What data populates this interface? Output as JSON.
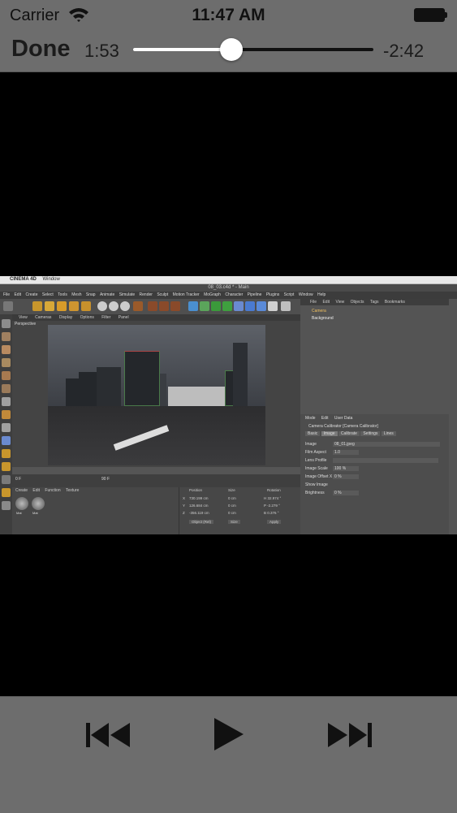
{
  "status_bar": {
    "carrier": "Carrier",
    "time": "11:47 AM",
    "wifi_icon": "wifi-icon",
    "battery_icon": "battery-icon"
  },
  "player": {
    "done_label": "Done",
    "elapsed": "1:53",
    "remaining": "-2:42",
    "progress_fraction": 0.41
  },
  "video": {
    "mac_menubar": [
      "CINEMA 4D",
      "Window"
    ],
    "window_title": "08_03.c4d * - Main",
    "menu": [
      "File",
      "Edit",
      "Create",
      "Select",
      "Tools",
      "Mesh",
      "Snap",
      "Animate",
      "Simulate",
      "Render",
      "Sculpt",
      "Motion Tracker",
      "MoGraph",
      "Character",
      "Pipeline",
      "Plugins",
      "Script",
      "Window",
      "Help"
    ],
    "view_menu": [
      "View",
      "Cameras",
      "Display",
      "Options",
      "Filter",
      "Panel"
    ],
    "viewport_label": "Perspective",
    "objects_header": [
      "File",
      "Edit",
      "View",
      "Objects",
      "Tags",
      "Bookmarks"
    ],
    "objects": [
      "Camera",
      "Background"
    ],
    "attributes_header": [
      "Mode",
      "Edit",
      "User Data"
    ],
    "attributes_title": "Camera Calibrator [Camera Calibrator]",
    "attributes_tabs": [
      "Basic",
      "Image",
      "Calibrate",
      "Settings",
      "Lines"
    ],
    "attributes_rows": [
      "Image",
      "Film Aspect",
      "Lens Profile",
      "Image Scale",
      "Image Offset X",
      "Show Image",
      "Brightness"
    ],
    "attributes_values": [
      "08_01.jpeg",
      "1.0",
      "",
      "100 %",
      "0 %",
      "",
      "0 %"
    ],
    "materials_menu": [
      "Create",
      "Edit",
      "Function",
      "Texture"
    ],
    "materials": [
      "Mat",
      "Mat"
    ],
    "coords_header": [
      "Position",
      "Size",
      "Rotation"
    ],
    "coords_rows": [
      [
        "X",
        "730.199 cm",
        "0 cm",
        "H 32.974 °"
      ],
      [
        "Y",
        "126.684 cm",
        "0 cm",
        "P -2.279 °"
      ],
      [
        "Z",
        "-356.119 cm",
        "0 cm",
        "B 0.376 °"
      ]
    ],
    "coords_buttons": [
      "Object (Rel)",
      "Size",
      "Apply"
    ],
    "timeline_frame": "0 F",
    "timeline_end": "90 F"
  },
  "controls": {
    "previous_icon": "skip-back-icon",
    "play_icon": "play-icon",
    "next_icon": "skip-forward-icon"
  }
}
